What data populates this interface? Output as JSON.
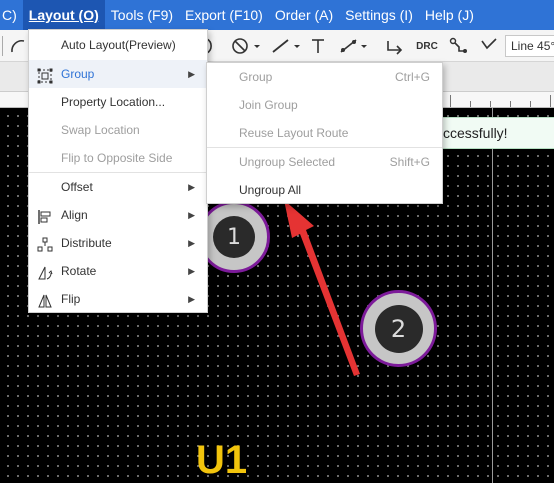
{
  "menubar": {
    "items": [
      "C)",
      "Layout (O)",
      "Tools (F9)",
      "Export (F10)",
      "Order (A)",
      "Settings (I)",
      "Help (J)"
    ],
    "active": "Layout (O)"
  },
  "toolbar": {
    "line_width": "Line 45°",
    "drc_label": "DRC",
    "text_tool_glyph": "T"
  },
  "layout_menu": {
    "items": [
      {
        "label": "Auto Layout(Preview)",
        "icon": "",
        "submenu": false,
        "disabled": false
      },
      {
        "label": "Group",
        "icon": "group-icon",
        "submenu": true,
        "disabled": false,
        "highlighted": true
      },
      {
        "label": "Property Location...",
        "icon": "",
        "submenu": false,
        "disabled": false
      },
      {
        "label": "Swap Location",
        "icon": "",
        "submenu": false,
        "disabled": true
      },
      {
        "label": "Flip to Opposite Side",
        "icon": "",
        "submenu": false,
        "disabled": true
      },
      {
        "label": "Offset",
        "icon": "",
        "submenu": true,
        "disabled": false
      },
      {
        "label": "Align",
        "icon": "align-icon",
        "submenu": true,
        "disabled": false
      },
      {
        "label": "Distribute",
        "icon": "distribute-icon",
        "submenu": true,
        "disabled": false
      },
      {
        "label": "Rotate",
        "icon": "rotate-icon",
        "submenu": true,
        "disabled": false
      },
      {
        "label": "Flip",
        "icon": "flip-icon",
        "submenu": true,
        "disabled": false
      }
    ]
  },
  "group_menu": {
    "items": [
      {
        "label": "Group",
        "shortcut": "Ctrl+G",
        "disabled": true
      },
      {
        "label": "Join Group",
        "shortcut": "",
        "disabled": true
      },
      {
        "label": "Reuse Layout Route",
        "shortcut": "",
        "disabled": true
      },
      {
        "label": "Ungroup Selected",
        "shortcut": "Shift+G",
        "disabled": true
      },
      {
        "label": "Ungroup All",
        "shortcut": "",
        "disabled": false
      }
    ]
  },
  "toast": {
    "text": "ccessfully!"
  },
  "canvas": {
    "pads": [
      "1",
      "2"
    ],
    "designator": "U1"
  },
  "colors": {
    "menubar": "#2f73d6",
    "pad_ring": "#7d1b9a",
    "designator": "#f2c40c",
    "annotation_arrow": "#e53333"
  }
}
